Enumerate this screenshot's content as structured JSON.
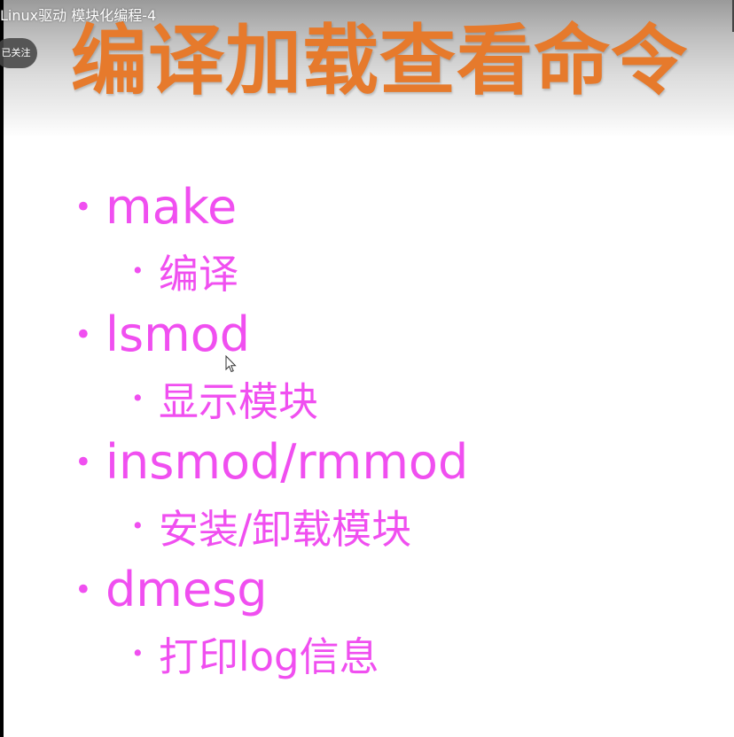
{
  "video": {
    "title": "Linux驱动 模块化编程-4",
    "follow_label": "已关注"
  },
  "slide": {
    "title": "编译加载查看命令",
    "items": [
      {
        "command": "make",
        "description": "编译"
      },
      {
        "command": "lsmod",
        "description": "显示模块"
      },
      {
        "command": "insmod/rmmod",
        "description": "安装/卸载模块"
      },
      {
        "command": "dmesg",
        "description": "打印log信息"
      }
    ]
  },
  "colors": {
    "title": "#e67a2c",
    "bullet_text": "#f04ff0"
  },
  "icons": {
    "bullet": "•",
    "cursor": "mouse-pointer-icon"
  }
}
